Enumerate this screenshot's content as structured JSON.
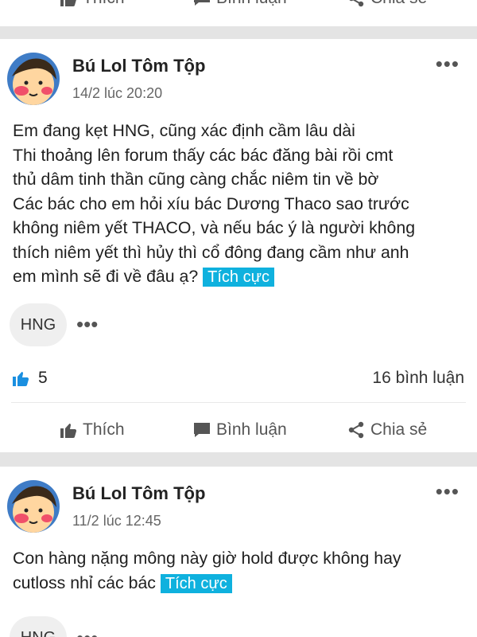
{
  "top_actions": {
    "like": "Thích",
    "comment": "Bình luận",
    "share": "Chia sẻ"
  },
  "posts": [
    {
      "author": "Bú Lol Tôm Tộp",
      "time": "14/2 lúc 20:20",
      "lines": [
        "Em đang kẹt HNG, cũng xác định cầm lâu dài",
        "Thi thoảng lên forum thấy các bác đăng bài rồi cmt",
        "thủ dâm tinh thần cũng càng chắc niêm tin về bờ",
        "Các bác cho em hỏi xíu bác Dương Thaco sao trước",
        "không niêm yết THACO, và nếu bác ý là người không",
        "thích niêm yết thì hủy thì cổ đông đang cầm như anh",
        "em mình sẽ đi về đâu ạ?"
      ],
      "tag": "Tích cực",
      "chip": "HNG",
      "likes": "5",
      "comments": "16 bình luận",
      "actions": {
        "like": "Thích",
        "comment": "Bình luận",
        "share": "Chia sẻ"
      }
    },
    {
      "author": "Bú Lol Tôm Tộp",
      "time": "11/2 lúc 12:45",
      "lines": [
        "Con hàng nặng mông này giờ hold được không hay",
        "cutloss nhỉ các bác"
      ],
      "tag": "Tích cực",
      "chip": "HNG"
    }
  ],
  "colors": {
    "accent": "#0fb1de",
    "like_blue": "#1a8fe0",
    "divider": "#e4e4e4"
  }
}
